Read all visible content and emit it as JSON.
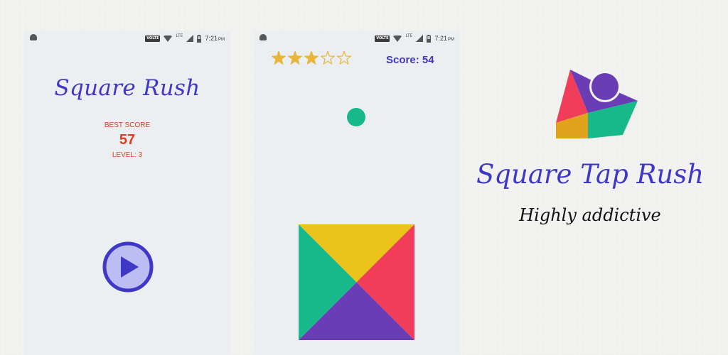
{
  "status_bar": {
    "network_badge": "VOLTE",
    "network_type": "LTE",
    "time": "7:21",
    "time_suffix": "PM"
  },
  "home_screen": {
    "title": "Square Rush",
    "best_score_label": "BEST SCORE",
    "best_score_value": "57",
    "level_label": "LEVEL: 3",
    "play_icon": "play-icon"
  },
  "game_screen": {
    "rating": {
      "filled": 3,
      "total": 5
    },
    "score_label": "Score: 54"
  },
  "promo": {
    "title": "Square Tap Rush",
    "tagline": "Highly addictive"
  },
  "colors": {
    "brand_blue": "#3f37c6",
    "accent_red": "#e03c20",
    "star_gold": "#eab53b",
    "square_yellow": "#ecc31a",
    "square_red": "#ef3d5a",
    "square_purple": "#6a3db5",
    "square_green": "#17b98a"
  }
}
